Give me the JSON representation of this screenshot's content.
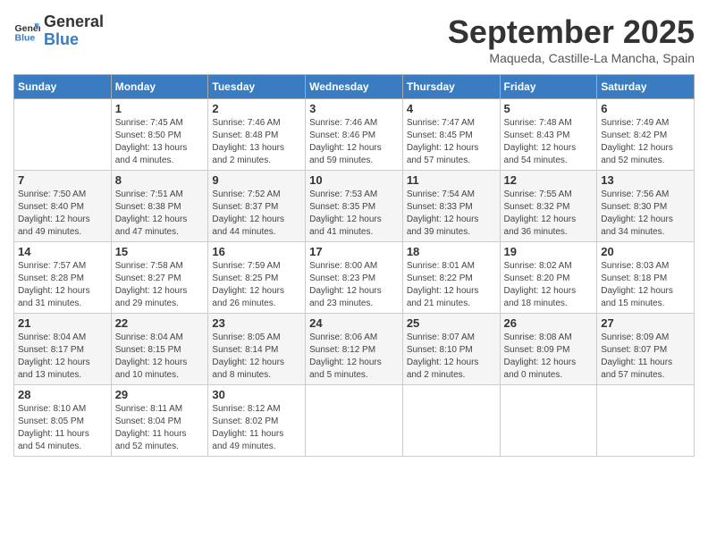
{
  "logo": {
    "line1": "General",
    "line2": "Blue"
  },
  "title": "September 2025",
  "location": "Maqueda, Castille-La Mancha, Spain",
  "headers": [
    "Sunday",
    "Monday",
    "Tuesday",
    "Wednesday",
    "Thursday",
    "Friday",
    "Saturday"
  ],
  "weeks": [
    [
      {
        "day": "",
        "info": ""
      },
      {
        "day": "1",
        "info": "Sunrise: 7:45 AM\nSunset: 8:50 PM\nDaylight: 13 hours\nand 4 minutes."
      },
      {
        "day": "2",
        "info": "Sunrise: 7:46 AM\nSunset: 8:48 PM\nDaylight: 13 hours\nand 2 minutes."
      },
      {
        "day": "3",
        "info": "Sunrise: 7:46 AM\nSunset: 8:46 PM\nDaylight: 12 hours\nand 59 minutes."
      },
      {
        "day": "4",
        "info": "Sunrise: 7:47 AM\nSunset: 8:45 PM\nDaylight: 12 hours\nand 57 minutes."
      },
      {
        "day": "5",
        "info": "Sunrise: 7:48 AM\nSunset: 8:43 PM\nDaylight: 12 hours\nand 54 minutes."
      },
      {
        "day": "6",
        "info": "Sunrise: 7:49 AM\nSunset: 8:42 PM\nDaylight: 12 hours\nand 52 minutes."
      }
    ],
    [
      {
        "day": "7",
        "info": "Sunrise: 7:50 AM\nSunset: 8:40 PM\nDaylight: 12 hours\nand 49 minutes."
      },
      {
        "day": "8",
        "info": "Sunrise: 7:51 AM\nSunset: 8:38 PM\nDaylight: 12 hours\nand 47 minutes."
      },
      {
        "day": "9",
        "info": "Sunrise: 7:52 AM\nSunset: 8:37 PM\nDaylight: 12 hours\nand 44 minutes."
      },
      {
        "day": "10",
        "info": "Sunrise: 7:53 AM\nSunset: 8:35 PM\nDaylight: 12 hours\nand 41 minutes."
      },
      {
        "day": "11",
        "info": "Sunrise: 7:54 AM\nSunset: 8:33 PM\nDaylight: 12 hours\nand 39 minutes."
      },
      {
        "day": "12",
        "info": "Sunrise: 7:55 AM\nSunset: 8:32 PM\nDaylight: 12 hours\nand 36 minutes."
      },
      {
        "day": "13",
        "info": "Sunrise: 7:56 AM\nSunset: 8:30 PM\nDaylight: 12 hours\nand 34 minutes."
      }
    ],
    [
      {
        "day": "14",
        "info": "Sunrise: 7:57 AM\nSunset: 8:28 PM\nDaylight: 12 hours\nand 31 minutes."
      },
      {
        "day": "15",
        "info": "Sunrise: 7:58 AM\nSunset: 8:27 PM\nDaylight: 12 hours\nand 29 minutes."
      },
      {
        "day": "16",
        "info": "Sunrise: 7:59 AM\nSunset: 8:25 PM\nDaylight: 12 hours\nand 26 minutes."
      },
      {
        "day": "17",
        "info": "Sunrise: 8:00 AM\nSunset: 8:23 PM\nDaylight: 12 hours\nand 23 minutes."
      },
      {
        "day": "18",
        "info": "Sunrise: 8:01 AM\nSunset: 8:22 PM\nDaylight: 12 hours\nand 21 minutes."
      },
      {
        "day": "19",
        "info": "Sunrise: 8:02 AM\nSunset: 8:20 PM\nDaylight: 12 hours\nand 18 minutes."
      },
      {
        "day": "20",
        "info": "Sunrise: 8:03 AM\nSunset: 8:18 PM\nDaylight: 12 hours\nand 15 minutes."
      }
    ],
    [
      {
        "day": "21",
        "info": "Sunrise: 8:04 AM\nSunset: 8:17 PM\nDaylight: 12 hours\nand 13 minutes."
      },
      {
        "day": "22",
        "info": "Sunrise: 8:04 AM\nSunset: 8:15 PM\nDaylight: 12 hours\nand 10 minutes."
      },
      {
        "day": "23",
        "info": "Sunrise: 8:05 AM\nSunset: 8:14 PM\nDaylight: 12 hours\nand 8 minutes."
      },
      {
        "day": "24",
        "info": "Sunrise: 8:06 AM\nSunset: 8:12 PM\nDaylight: 12 hours\nand 5 minutes."
      },
      {
        "day": "25",
        "info": "Sunrise: 8:07 AM\nSunset: 8:10 PM\nDaylight: 12 hours\nand 2 minutes."
      },
      {
        "day": "26",
        "info": "Sunrise: 8:08 AM\nSunset: 8:09 PM\nDaylight: 12 hours\nand 0 minutes."
      },
      {
        "day": "27",
        "info": "Sunrise: 8:09 AM\nSunset: 8:07 PM\nDaylight: 11 hours\nand 57 minutes."
      }
    ],
    [
      {
        "day": "28",
        "info": "Sunrise: 8:10 AM\nSunset: 8:05 PM\nDaylight: 11 hours\nand 54 minutes."
      },
      {
        "day": "29",
        "info": "Sunrise: 8:11 AM\nSunset: 8:04 PM\nDaylight: 11 hours\nand 52 minutes."
      },
      {
        "day": "30",
        "info": "Sunrise: 8:12 AM\nSunset: 8:02 PM\nDaylight: 11 hours\nand 49 minutes."
      },
      {
        "day": "",
        "info": ""
      },
      {
        "day": "",
        "info": ""
      },
      {
        "day": "",
        "info": ""
      },
      {
        "day": "",
        "info": ""
      }
    ]
  ]
}
